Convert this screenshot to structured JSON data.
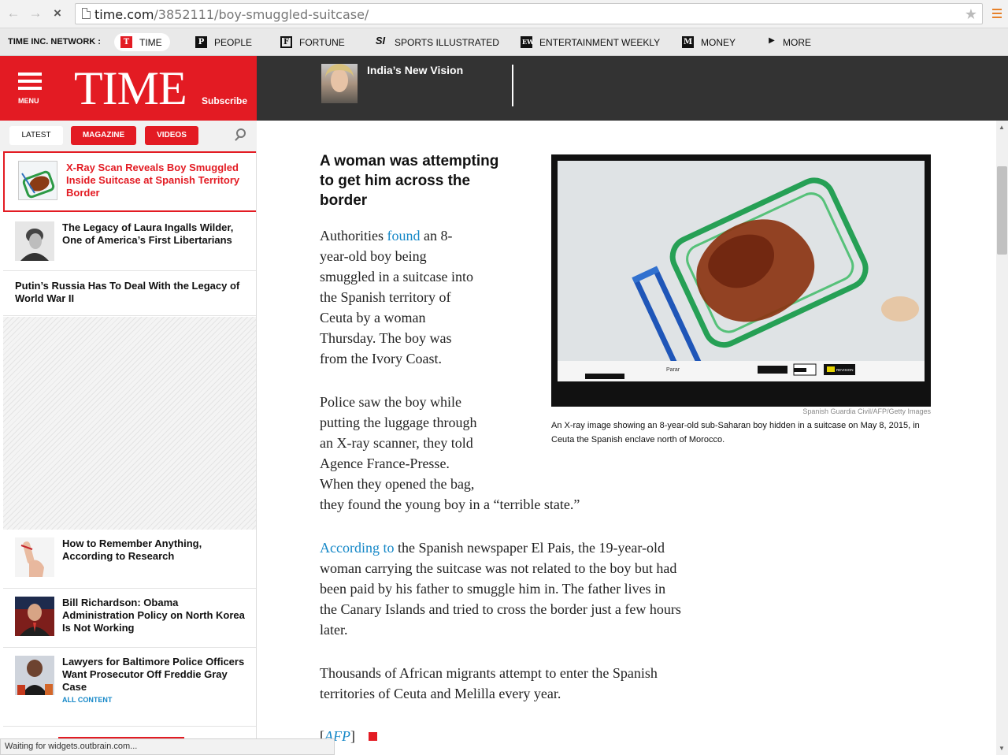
{
  "browser": {
    "url_host": "time.com",
    "url_path": "/3852111/boy-smuggled-suitcase/",
    "status_text": "Waiting for widgets.outbrain.com..."
  },
  "network": {
    "title": "TIME INC. NETWORK :",
    "items": [
      {
        "label": "TIME",
        "logo": "T"
      },
      {
        "label": "PEOPLE",
        "logo": "P"
      },
      {
        "label": "FORTUNE",
        "logo": "F"
      },
      {
        "label": "SPORTS ILLUSTRATED",
        "logo": "SI"
      },
      {
        "label": "ENTERTAINMENT WEEKLY",
        "logo": "EW"
      },
      {
        "label": "MONEY",
        "logo": "M"
      },
      {
        "label": "MORE",
        "logo": "▶"
      }
    ]
  },
  "header": {
    "menu_label": "MENU",
    "logo": "TIME",
    "subscribe": "Subscribe",
    "promo_title": "India’s New Vision"
  },
  "sidebar": {
    "tabs": [
      "LATEST",
      "MAGAZINE",
      "VIDEOS"
    ],
    "items": [
      {
        "title": "X-Ray Scan Reveals Boy Smuggled Inside Suitcase at Spanish Territory Border"
      },
      {
        "title": "The Legacy of Laura Ingalls Wilder, One of America’s First Libertarians"
      },
      {
        "title": "Putin’s Russia Has To Deal With the Legacy of World War II"
      },
      {
        "title": "How to Remember Anything, According to Research"
      },
      {
        "title": "Bill Richardson: Obama Administration Policy on North Korea Is Not Working"
      },
      {
        "title": "Lawyers for Baltimore Police Officers Want Prosecutor Off Freddie Gray Case"
      }
    ],
    "all_content": "ALL CONTENT"
  },
  "article": {
    "subhead": "A woman was attempting to get him across the border",
    "p1": {
      "before": "Authorities ",
      "link": "found",
      "after_lines": [
        " an 8-",
        "year-old boy being",
        "smuggled in a suitcase into",
        "the Spanish territory of",
        "Ceuta by a woman",
        "Thursday. The boy was",
        "from the Ivory Coast."
      ]
    },
    "p2_lines": [
      "Police saw the boy while",
      "putting the luggage through",
      "an X-ray scanner, they told",
      "Agence France-Presse.",
      "When they opened the bag,",
      "they found the young boy in a “terrible state.”"
    ],
    "p3": {
      "link": "According to",
      "lines": [
        " the Spanish newspaper El Pais, the 19-year-old",
        "woman carrying the suitcase was not related to the boy but had",
        "been paid by his father to smuggle him in. The father lives in",
        "the Canary Islands and tried to cross the border just a few hours",
        "later."
      ]
    },
    "p4_lines": [
      "Thousands of African migrants attempt to enter the Spanish",
      "territories of Ceuta and Melilla every year."
    ],
    "source_link": "AFP",
    "photo_credit": "Spanish Guardia Civil/AFP/Getty Images",
    "caption": "An X-ray image showing an 8-year-old sub-Saharan boy hidden in a suitcase on May 8, 2015, in Ceuta the Spanish enclave north of Morocco.",
    "screen_labels": [
      "Parar",
      "REVISION"
    ]
  }
}
